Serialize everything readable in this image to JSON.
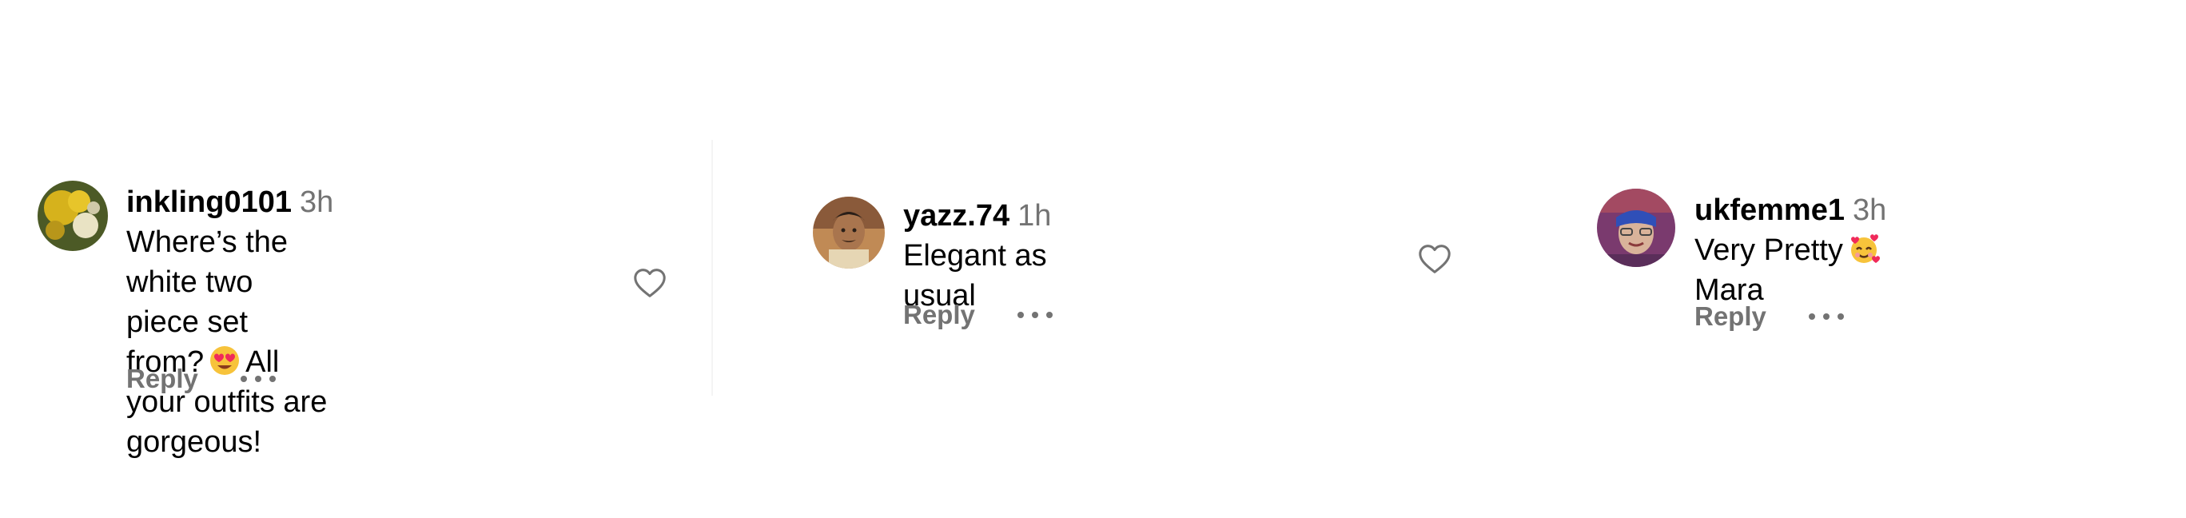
{
  "comments": [
    {
      "username": "inkling0101",
      "time": "3h",
      "text_line1": "Where’s the white two piece set",
      "text_line2_before": "from?",
      "text_line2_after": "All your outfits are",
      "text_line3": "gorgeous!",
      "emoji_icon": "heart-eyes-face-icon",
      "reply_label": "Reply",
      "avatar_colors": {
        "primary": "#d6b21c",
        "secondary": "#5b6b2a",
        "accent": "#e9e3c4"
      }
    },
    {
      "username": "yazz.74",
      "time": "1h",
      "text": "Elegant as usual",
      "reply_label": "Reply",
      "avatar_colors": {
        "primary": "#6b4a33",
        "secondary": "#caa57e",
        "accent": "#2a1f18"
      }
    },
    {
      "username": "ukfemme1",
      "time": "3h",
      "text_before": "Very Pretty",
      "text_after": "Mara",
      "emoji_icon": "smiling-face-with-hearts-icon",
      "reply_label": "Reply",
      "avatar_colors": {
        "primary": "#7a3a6e",
        "secondary": "#2f4fb8",
        "accent": "#d9b39a"
      }
    }
  ],
  "colors": {
    "secondary_text": "#737373",
    "divider": "#f4f4f4",
    "icon_gray": "#737373"
  }
}
